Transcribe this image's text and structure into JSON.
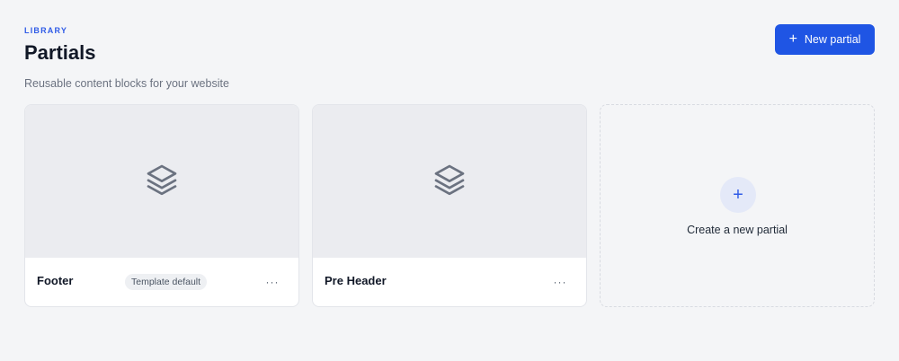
{
  "header": {
    "eyebrow": "LIBRARY",
    "title": "Partials",
    "subtitle": "Reusable content blocks for your website"
  },
  "actions": {
    "new_button_icon": "plus-icon",
    "new_button_label": "New partial"
  },
  "partials": [
    {
      "name": "Footer",
      "badge": "Template default",
      "icon": "layers-icon",
      "menu": "···"
    },
    {
      "name": "Pre Header",
      "badge": "",
      "icon": "layers-icon",
      "menu": "···"
    }
  ],
  "create": {
    "icon": "plus-icon",
    "label": "Create a new partial"
  },
  "colors": {
    "accent": "#1f55e4",
    "background": "#f4f5f7",
    "preview": "#ebecf0"
  }
}
